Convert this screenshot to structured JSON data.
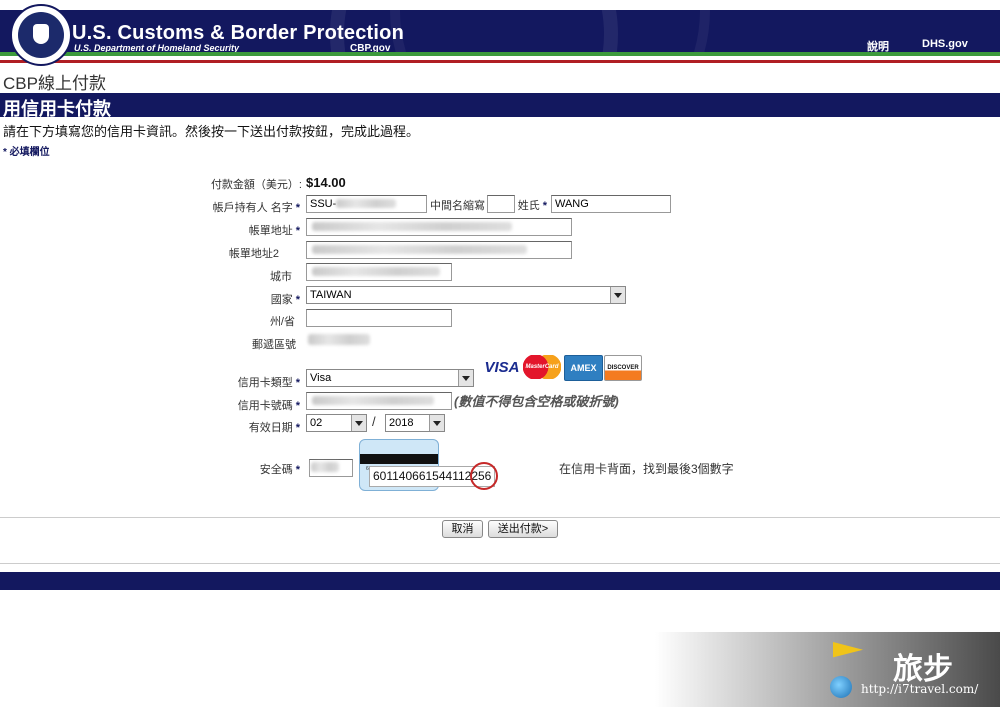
{
  "header": {
    "agency_title": "U.S. Customs & Border Protection",
    "agency_subtitle": "U.S. Department of Homeland Security",
    "agency_url": "CBP.gov",
    "seal_text": "U.S. DEPARTMENT OF HOMELAND SECURITY",
    "nav": {
      "help": "說明",
      "dhs": "DHS.gov"
    },
    "colors": {
      "navy": "#13185f",
      "green": "#3c9a3c",
      "red": "#b01e23"
    }
  },
  "page_title": "CBP線上付款",
  "section_title": "用信用卡付款",
  "instructions": "請在下方填寫您的信用卡資訊。然後按一下送出付款按鈕，完成此過程。",
  "required_note": "* 必填欄位",
  "form": {
    "amount_label": "付款金額（美元）:",
    "amount_value": "$14.00",
    "holder_label": "帳戶持有人 名字",
    "first_name_value": "SSU-",
    "middle_label": "中間名縮寫",
    "last_name_label": "姓氏",
    "last_name_value": "WANG",
    "address1_label": "帳單地址",
    "address2_label": "帳單地址2",
    "city_label": "城市",
    "country_label": "國家",
    "country_value": "TAIWAN",
    "state_label": "州/省",
    "zip_label": "郵遞區號",
    "card_type_label": "信用卡類型",
    "card_type_value": "Visa",
    "card_number_label": "信用卡號碼",
    "card_number_hint": "(數值不得包含空格或破折號)",
    "expiry_label": "有效日期",
    "expiry_month": "02",
    "expiry_separator": "/",
    "expiry_year": "2018",
    "cvv_label": "安全碼",
    "cvv_sample_number": "601140661544112",
    "cvv_sample_digits": "256",
    "cvv_hint": "在信用卡背面，找到最後3個數字",
    "required_marker": "*"
  },
  "card_logos": [
    "VISA",
    "MasterCard",
    "AMEX",
    "DISCOVER"
  ],
  "buttons": {
    "cancel": "取消",
    "submit": "送出付款>"
  },
  "watermark": {
    "title": "旅步",
    "url": "http://i7travel.com/"
  }
}
